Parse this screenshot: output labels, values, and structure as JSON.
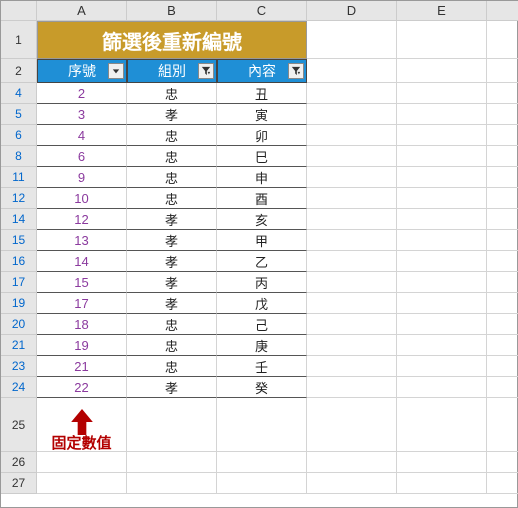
{
  "columns": [
    "A",
    "B",
    "C",
    "D",
    "E",
    "F"
  ],
  "title": "篩選後重新編號",
  "headers": {
    "a": "序號",
    "b": "組別",
    "c": "內容"
  },
  "rows": [
    {
      "r": 4,
      "a": "2",
      "b": "忠",
      "c": "丑"
    },
    {
      "r": 5,
      "a": "3",
      "b": "孝",
      "c": "寅"
    },
    {
      "r": 6,
      "a": "4",
      "b": "忠",
      "c": "卯"
    },
    {
      "r": 8,
      "a": "6",
      "b": "忠",
      "c": "巳"
    },
    {
      "r": 11,
      "a": "9",
      "b": "忠",
      "c": "申"
    },
    {
      "r": 12,
      "a": "10",
      "b": "忠",
      "c": "酉"
    },
    {
      "r": 14,
      "a": "12",
      "b": "孝",
      "c": "亥"
    },
    {
      "r": 15,
      "a": "13",
      "b": "孝",
      "c": "甲"
    },
    {
      "r": 16,
      "a": "14",
      "b": "孝",
      "c": "乙"
    },
    {
      "r": 17,
      "a": "15",
      "b": "孝",
      "c": "丙"
    },
    {
      "r": 19,
      "a": "17",
      "b": "孝",
      "c": "戊"
    },
    {
      "r": 20,
      "a": "18",
      "b": "忠",
      "c": "己"
    },
    {
      "r": 21,
      "a": "19",
      "b": "忠",
      "c": "庚"
    },
    {
      "r": 23,
      "a": "21",
      "b": "忠",
      "c": "壬"
    },
    {
      "r": 24,
      "a": "22",
      "b": "孝",
      "c": "癸"
    }
  ],
  "annotation": "固定數值",
  "tail_rows": [
    25,
    26,
    27
  ],
  "chart_data": {
    "type": "table",
    "title": "篩選後重新編號",
    "columns": [
      "序號",
      "組別",
      "內容"
    ],
    "rows": [
      [
        2,
        "忠",
        "丑"
      ],
      [
        3,
        "孝",
        "寅"
      ],
      [
        4,
        "忠",
        "卯"
      ],
      [
        6,
        "忠",
        "巳"
      ],
      [
        9,
        "忠",
        "申"
      ],
      [
        10,
        "忠",
        "酉"
      ],
      [
        12,
        "孝",
        "亥"
      ],
      [
        13,
        "孝",
        "甲"
      ],
      [
        14,
        "孝",
        "乙"
      ],
      [
        15,
        "孝",
        "丙"
      ],
      [
        17,
        "孝",
        "戊"
      ],
      [
        18,
        "忠",
        "己"
      ],
      [
        19,
        "忠",
        "庚"
      ],
      [
        21,
        "忠",
        "壬"
      ],
      [
        22,
        "孝",
        "癸"
      ]
    ],
    "note": "固定數值"
  }
}
